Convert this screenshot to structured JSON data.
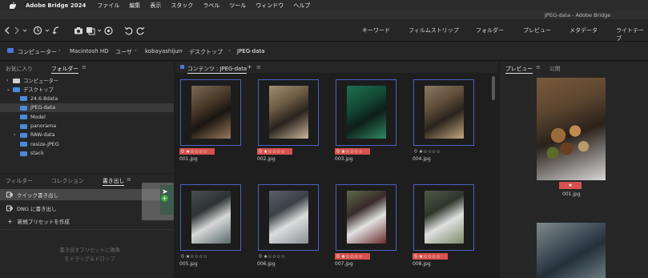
{
  "menubar": {
    "app": "Adobe Bridge 2024",
    "items": [
      "ファイル",
      "編集",
      "表示",
      "スタック",
      "ラベル",
      "ツール",
      "ウィンドウ",
      "ヘルプ"
    ]
  },
  "window": {
    "title": "JPEG-data - Adobe Bridge"
  },
  "workspaces": [
    "キーワード",
    "フィルムストリップ",
    "フォルダー",
    "プレビュー",
    "メタデータ",
    "ライトテーブ"
  ],
  "path": [
    "コンピューター",
    "Macintosh HD",
    "ユーザ",
    "kobayashijun",
    "デスクトップ",
    "JPEG-data"
  ],
  "left_top_tabs": {
    "favorites": "お気に入り",
    "folders": "フォルダー"
  },
  "folders": [
    {
      "label": "コンピューター",
      "level": 0,
      "expanded": false
    },
    {
      "label": "デスクトップ",
      "level": 0,
      "expanded": true
    },
    {
      "label": "24.6.8data",
      "level": 1,
      "expanded": false
    },
    {
      "label": "JPEG-data",
      "level": 1,
      "expanded": false,
      "selected": true
    },
    {
      "label": "Model",
      "level": 1,
      "expanded": false
    },
    {
      "label": "panorama",
      "level": 1,
      "expanded": false
    },
    {
      "label": "RAW-data",
      "level": 1,
      "expanded": false
    },
    {
      "label": "resize-JPEG",
      "level": 1,
      "expanded": false
    },
    {
      "label": "stack",
      "level": 1,
      "expanded": false
    }
  ],
  "left_bottom_tabs": {
    "filter": "フィルター",
    "collection": "コレクション",
    "export": "書き出し"
  },
  "export": {
    "quick": "クイック書き出し",
    "dng": "DNG に書き出し",
    "new_preset": "新規プリセットを作成",
    "hint_line1": "書き出すプリセットに画像",
    "hint_line2": "をドラッグ＆ドロップ"
  },
  "content": {
    "tab": "コンテンツ : JPEG-data"
  },
  "thumbnails": [
    {
      "file": "001.jpg",
      "rating": "★☆☆☆☆",
      "rejected": true,
      "red": true
    },
    {
      "file": "002.jpg",
      "rating": "★☆☆☆☆",
      "rejected": true,
      "red": true
    },
    {
      "file": "003.jpg",
      "rating": "★☆☆☆☆",
      "rejected": true,
      "red": true
    },
    {
      "file": "004.jpg",
      "rating": "★☆☆☆☆",
      "rejected": true,
      "red": false
    },
    {
      "file": "005.jpg",
      "rating": "★☆☆☆☆",
      "rejected": true,
      "red": false
    },
    {
      "file": "006.jpg",
      "rating": "★☆☆☆☆",
      "rejected": true,
      "red": false
    },
    {
      "file": "007.jpg",
      "rating": "★☆☆☆☆",
      "rejected": true,
      "red": true
    },
    {
      "file": "008.jpg",
      "rating": "★☆☆☆☆",
      "rejected": true,
      "red": true
    }
  ],
  "preview_tabs": {
    "preview": "プレビュー",
    "publish": "公開"
  },
  "preview": {
    "rating": "★",
    "file": "001.jpg"
  },
  "colors": {
    "accent": "#4a62c2",
    "label_red": "#d6524e",
    "panel": "#262626",
    "bg": "#1e1e1e"
  }
}
